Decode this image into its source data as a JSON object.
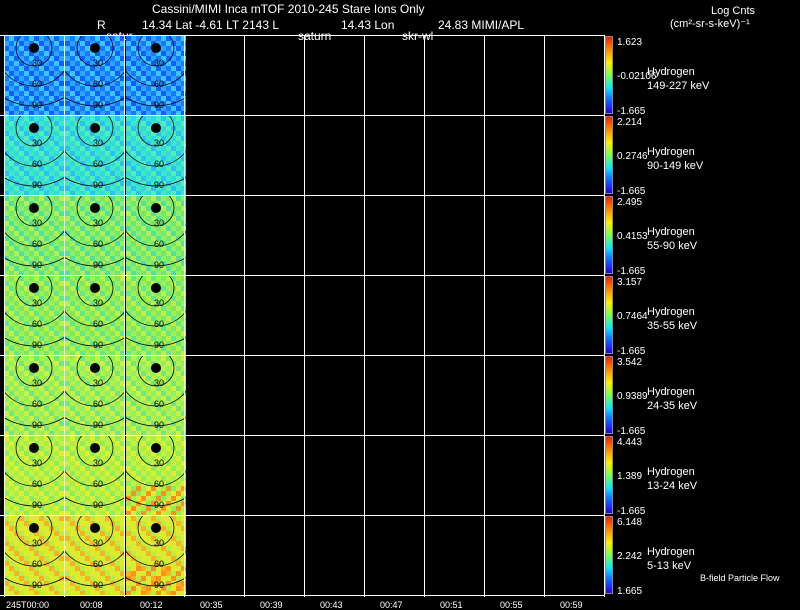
{
  "header": {
    "title": "Cassini/MIMI Inca mTOF  2010-245   Stare    Ions Only",
    "line2_r": "R",
    "line2_vals": "14.34 Lat -4.61 LT 2143 L",
    "line2_lon": "14.43 Lon",
    "line2_right": "24.83  MIMI/APL",
    "sub_satur": "satur",
    "sub_saturn": "saturn",
    "sub_skrwl": "skr-wl",
    "units_line1": "Log Cnts",
    "units_line2": "(cm²-sr-s-keV)⁻¹"
  },
  "panels": [
    {
      "species": "Hydrogen",
      "energy": "149-227 keV",
      "cbar_max": "1.623",
      "cbar_mid": "-0.02106",
      "cbar_min": "-1.665"
    },
    {
      "species": "Hydrogen",
      "energy": "90-149 keV",
      "cbar_max": "2.214",
      "cbar_mid": "0.2746",
      "cbar_min": "-1.665"
    },
    {
      "species": "Hydrogen",
      "energy": "55-90 keV",
      "cbar_max": "2.495",
      "cbar_mid": "0.4153",
      "cbar_min": "-1.665"
    },
    {
      "species": "Hydrogen",
      "energy": "35-55 keV",
      "cbar_max": "3.157",
      "cbar_mid": "0.7464",
      "cbar_min": "-1.665"
    },
    {
      "species": "Hydrogen",
      "energy": "24-35 keV",
      "cbar_max": "3.542",
      "cbar_mid": "0.9389",
      "cbar_min": "-1.665"
    },
    {
      "species": "Hydrogen",
      "energy": "13-24 keV",
      "cbar_max": "4.443",
      "cbar_mid": "1.389",
      "cbar_min": "-1.665"
    },
    {
      "species": "Hydrogen",
      "energy": "5-13 keV",
      "cbar_max": "6.148",
      "cbar_mid": "2.242",
      "cbar_min": "1.665"
    }
  ],
  "angle_labels": [
    "30",
    "60",
    "90"
  ],
  "time_ticks": [
    "245T00:00",
    "00:08",
    "00:12",
    "00:35",
    "00:39",
    "00:43",
    "00:47",
    "00:51",
    "00:55",
    "00:59"
  ],
  "footer_note": "B-field Particle Flow",
  "colors": {
    "low": "#1060ff",
    "mid": "#7cff50",
    "high": "#ffee00",
    "max": "#ff1a00"
  }
}
